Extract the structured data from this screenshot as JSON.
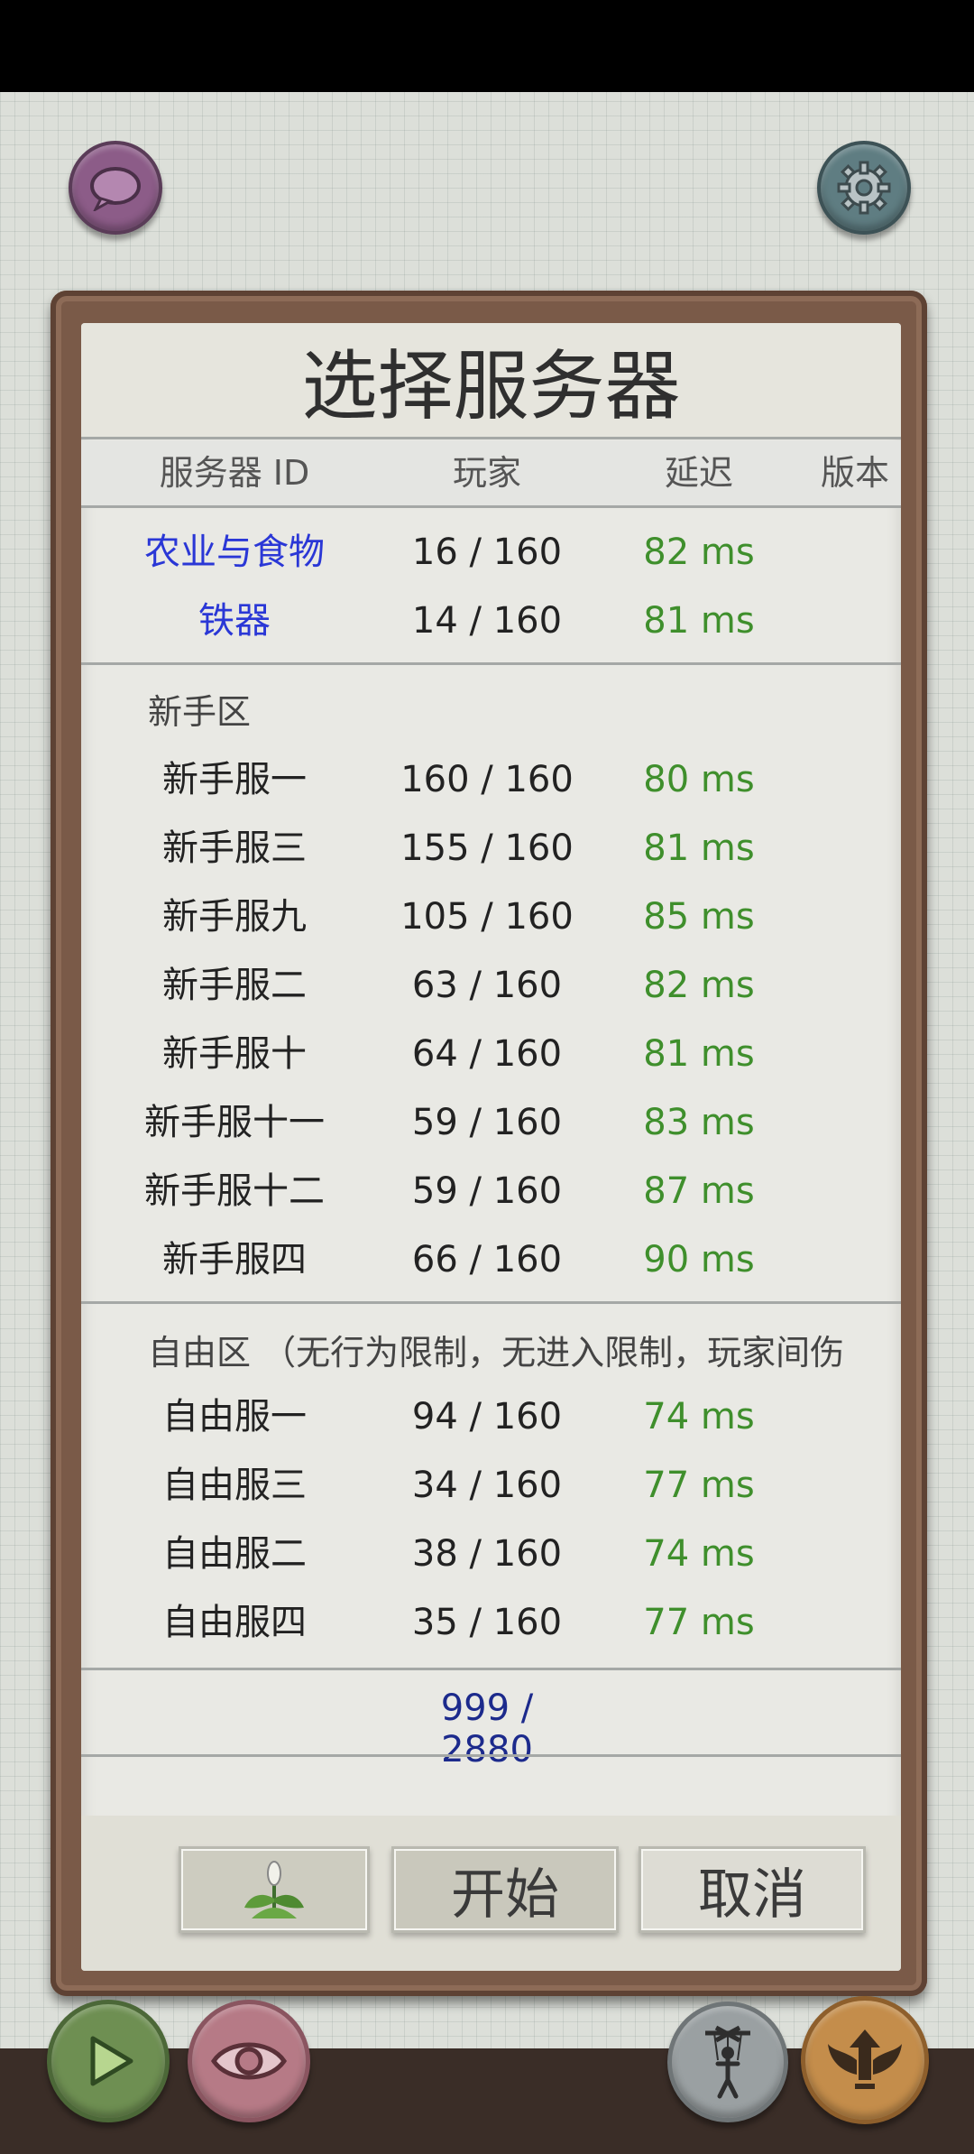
{
  "dialog": {
    "title": "选择服务器",
    "columns": {
      "name": "服务器 ID",
      "players": "玩家",
      "ping": "延迟",
      "version": "版本"
    },
    "favorites": [
      {
        "name": "农业与食物",
        "players": "16 / 160",
        "ping": "82 ms"
      },
      {
        "name": "铁器",
        "players": "14 / 160",
        "ping": "81 ms"
      }
    ],
    "novice_section": {
      "label": "新手区",
      "servers": [
        {
          "name": "新手服一",
          "players": "160 / 160",
          "ping": "80 ms"
        },
        {
          "name": "新手服三",
          "players": "155 / 160",
          "ping": "81 ms"
        },
        {
          "name": "新手服九",
          "players": "105 / 160",
          "ping": "85 ms"
        },
        {
          "name": "新手服二",
          "players": "63 / 160",
          "ping": "82 ms"
        },
        {
          "name": "新手服十",
          "players": "64 / 160",
          "ping": "81 ms"
        },
        {
          "name": "新手服十一",
          "players": "59 / 160",
          "ping": "83 ms"
        },
        {
          "name": "新手服十二",
          "players": "59 / 160",
          "ping": "87 ms"
        },
        {
          "name": "新手服四",
          "players": "66 / 160",
          "ping": "90 ms"
        }
      ]
    },
    "free_section": {
      "label": "自由区 （无行为限制，无进入限制，玩家间伤",
      "servers": [
        {
          "name": "自由服一",
          "players": "94 / 160",
          "ping": "74 ms"
        },
        {
          "name": "自由服三",
          "players": "34 / 160",
          "ping": "77 ms"
        },
        {
          "name": "自由服二",
          "players": "38 / 160",
          "ping": "74 ms"
        },
        {
          "name": "自由服四",
          "players": "35 / 160",
          "ping": "77 ms"
        }
      ]
    },
    "total_players": "999 / 2880",
    "buttons": {
      "start": "开始",
      "cancel": "取消"
    }
  },
  "colors": {
    "ping_green": "#3f8f2c",
    "favorite_blue": "#2a37d6",
    "total_navy": "#1c2a8c"
  },
  "icons": [
    "chat-bubble-icon",
    "gear-icon",
    "plant-icon",
    "play-icon",
    "eye-icon",
    "puppet-icon",
    "upgrade-wings-icon"
  ]
}
